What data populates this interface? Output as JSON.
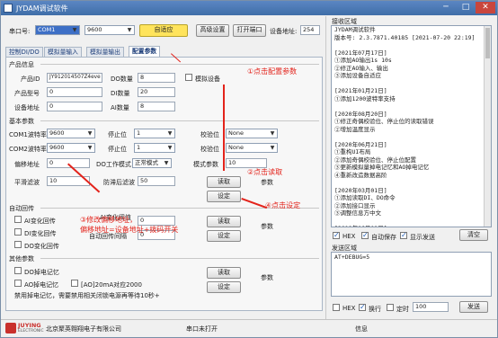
{
  "window": {
    "title": "JYDAM调试软件",
    "minimize": "─",
    "maximize": "□",
    "close": "✕"
  },
  "toolbar": {
    "port_label": "串口号:",
    "port_value": "COM1",
    "baud_value": "9600",
    "auto_button": "自适应",
    "advanced_button": "高级设置",
    "open_button": "打开端口",
    "device_addr_label": "设备地址:",
    "device_addr_value": "254"
  },
  "tabs": [
    {
      "label": "控制DI/DO"
    },
    {
      "label": "模拟量输入"
    },
    {
      "label": "模拟量输出"
    },
    {
      "label": "配置参数"
    }
  ],
  "product": {
    "section_title": "产品信息",
    "id_label": "产品ID",
    "id_value": "JY912014507Z4eve",
    "do_count_label": "DO数量",
    "do_count_value": "8",
    "analog_device_label": "模拟设备",
    "model_label": "产品型号",
    "model_value": "0",
    "di_count_label": "DI数量",
    "di_count_value": "20",
    "addr_label": "设备地址",
    "addr_value": "0",
    "ai_count_label": "AI数量",
    "ai_count_value": "8"
  },
  "basic": {
    "section_title": "基本参数",
    "com1_label": "COM1波特率",
    "com1_value": "9600",
    "com2_label": "COM2波特率",
    "com2_value": "9600",
    "stop1_label": "停止位",
    "stop1_value": "1",
    "stop2_label": "停止位",
    "stop2_value": "1",
    "parity1_label": "校验位",
    "parity1_value": "None",
    "parity2_label": "校验位",
    "parity2_value": "None",
    "offset_label": "偏移地址",
    "offset_value": "0",
    "do_mode_label": "DO工作模式",
    "do_mode_value": "正常模式",
    "mode_param_label": "模式参数",
    "mode_param_value": "10",
    "filter_label": "平滑滤波",
    "filter_value": "10",
    "jitter_label": "防滞后滤波",
    "jitter_value": "50",
    "read_button": "读取",
    "set_button": "设定",
    "param_label": "参数"
  },
  "auto_report": {
    "section_title": "自动回传",
    "ai_label": "AI变化回传",
    "di_label": "DI变化回传",
    "do_label": "DO变化回传",
    "ai_threshold_label": "AI变化阈值",
    "ai_threshold_value": "0",
    "auto_interval_label": "自动回传间隔",
    "auto_interval_value": "0",
    "read_button": "读取",
    "set_button": "设定",
    "param_label": "参数"
  },
  "other": {
    "section_title": "其他参数",
    "do_power_label": "DO掉电记忆",
    "ao_power_label": "AO掉电记忆",
    "ao_range_label": "[AO]20mA对应2000",
    "note": "禁用掉电记忆，需要禁用相关闭锁电源再等待10秒+",
    "read_button": "读取",
    "set_button": "设定",
    "param_label": "参数"
  },
  "annotations": {
    "a1": "①点击配置参数",
    "a2": "②点击读取",
    "a3_line1": "③修改偏移地址，",
    "a3_line2": "偏移地址=设备地址+拨码开关",
    "a4": "④点击设定"
  },
  "receive": {
    "title": "接收区域",
    "lines": [
      "JYDAM调试软件",
      "版本号: 2.3.7871.40185 [2021-07-20 22:19]",
      "",
      "[2021年07月17日]",
      "①添加AO输出1s 10s",
      "②修正AO输入、输出",
      "③添加设备自适应",
      "",
      "[2021年01月21日]",
      "①添加1200波特率支持",
      "",
      "[2020年08月20日]",
      "①修正奇偶校验位、停止位的读取错误",
      "②增加温度显示",
      "",
      "[2020年06月21日]",
      "①重构UI布局",
      "②添加奇偶校验位、停止位配置",
      "③更新模拟量掉电记忆和AO掉电记忆",
      "④重新改造数据高阶",
      "",
      "[2020年03月01日]",
      "①添加读取DI、DO命令",
      "②添加接口显示",
      "③调整信息方中文",
      "",
      "[2019年06月01日]",
      "①更新曲线显示"
    ],
    "hex_label": "HEX",
    "auto_save_label": "自动保存",
    "show_send_label": "显示发送",
    "clear_button": "清空"
  },
  "send": {
    "title": "发送区域",
    "content": "AT+DEBUG=5",
    "hex_label": "HEX",
    "newline_label": "换行",
    "timer_label": "定时",
    "timer_value": "100",
    "send_button": "发送"
  },
  "status": {
    "company": "北京聚英翱翔电子有限公司",
    "logo_main": "JUYING",
    "logo_sub": "ELECTRONIC",
    "port_status": "串口未打开",
    "info": "信息"
  },
  "colors": {
    "annotation": "#e3231b",
    "title_bar": "#4a78b5",
    "active_button": "#ffe45c"
  }
}
